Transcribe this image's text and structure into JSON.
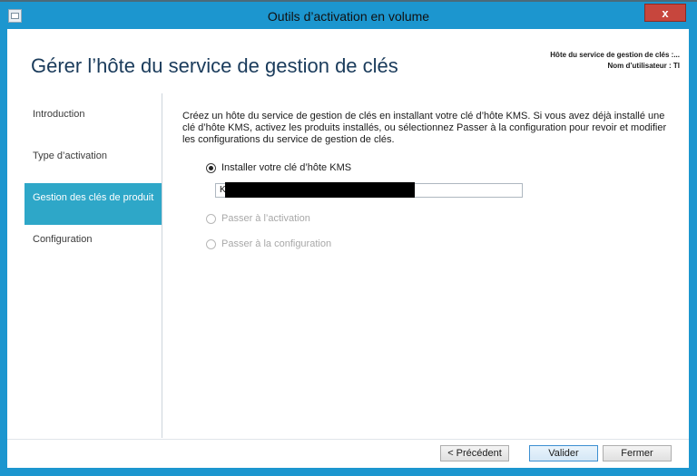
{
  "window": {
    "title": "Outils d’activation en volume",
    "close_label": "x"
  },
  "header": {
    "page_title": "Gérer l’hôte du service de gestion de clés",
    "host_label": "Hôte du service de gestion de clés :...",
    "user_label": "Nom d’utilisateur : TI"
  },
  "nav": {
    "items": [
      {
        "label": "Introduction",
        "active": false
      },
      {
        "label": "Type d’activation",
        "active": false
      },
      {
        "label": "Gestion des clés de produit",
        "active": true
      },
      {
        "label": "Configuration",
        "active": false
      }
    ]
  },
  "main": {
    "description": "Créez un hôte du service de gestion de clés en installant votre clé d’hôte KMS. Si vous avez déjà installé une clé d’hôte KMS, activez les produits installés, ou sélectionnez Passer à la configuration pour revoir et modifier les configurations du service de gestion de clés.",
    "options": [
      {
        "label": "Installer votre clé d’hôte KMS",
        "checked": true,
        "enabled": true
      },
      {
        "label": "Passer à l’activation",
        "checked": false,
        "enabled": false
      },
      {
        "label": "Passer à la configuration",
        "checked": false,
        "enabled": false
      }
    ],
    "key_input_value": "KH"
  },
  "footer": {
    "previous_label": "< Précédent",
    "validate_label": "Valider",
    "close_label": "Fermer"
  },
  "colors": {
    "titlebar": "#1c96cf",
    "nav_active": "#2ea7c8",
    "close_button": "#c7463d"
  }
}
